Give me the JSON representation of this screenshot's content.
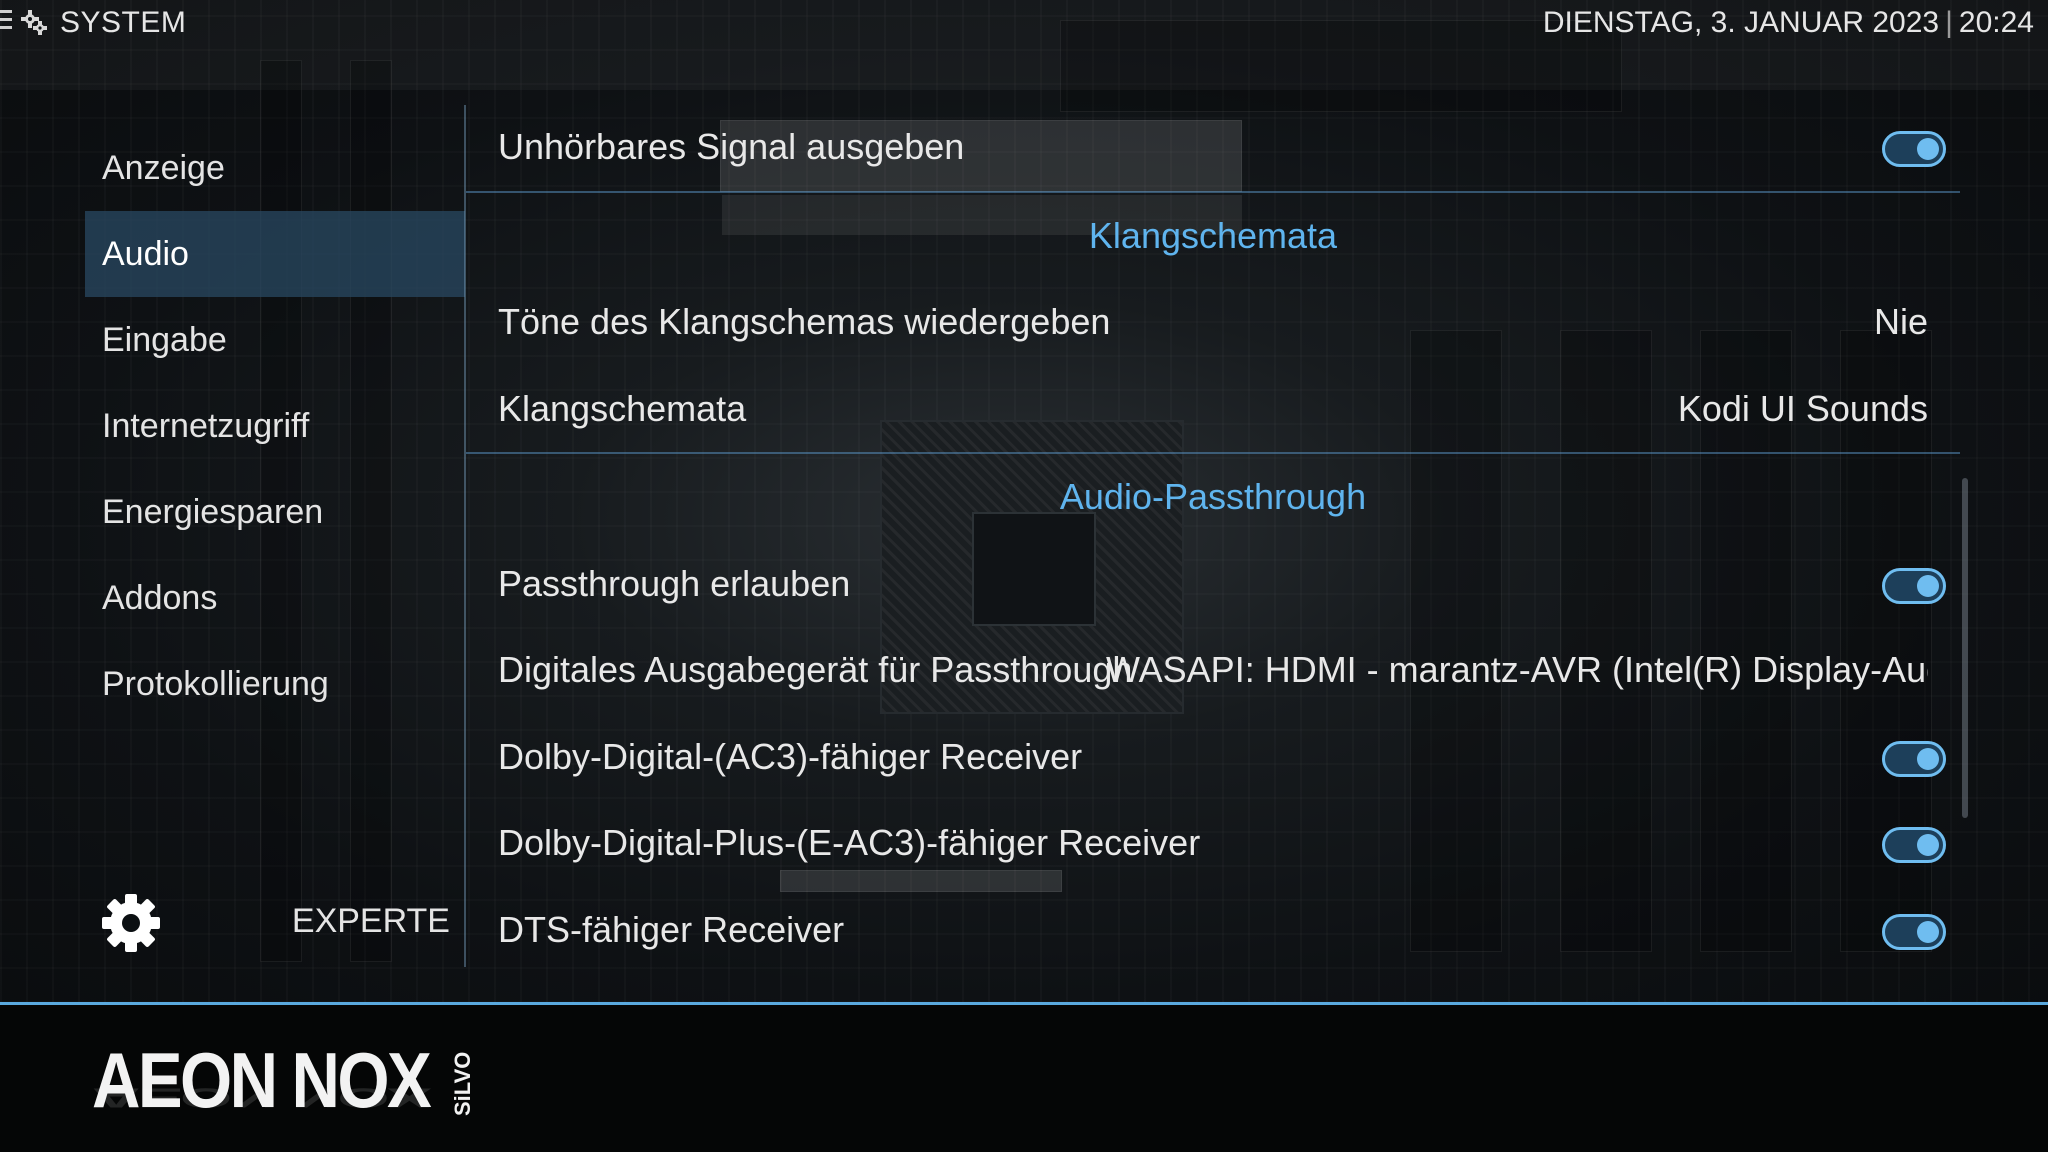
{
  "header": {
    "section_title": "SYSTEM",
    "date": "DIENSTAG, 3. JANUAR 2023",
    "separator": "|",
    "time": "20:24"
  },
  "sidebar": {
    "items": [
      {
        "label": "Anzeige",
        "active": false
      },
      {
        "label": "Audio",
        "active": true
      },
      {
        "label": "Eingabe",
        "active": false
      },
      {
        "label": "Internetzugriff",
        "active": false
      },
      {
        "label": "Energiesparen",
        "active": false
      },
      {
        "label": "Addons",
        "active": false
      },
      {
        "label": "Protokollierung",
        "active": false
      }
    ],
    "level_label": "EXPERTE",
    "level_icon": "gear-icon"
  },
  "settings": {
    "row0": {
      "label": "Unhörbares Signal ausgeben",
      "toggle": true
    },
    "section1": "Klangschemata",
    "row1": {
      "label": "Töne des Klangschemas wiedergeben",
      "value": "Nie"
    },
    "row2": {
      "label": "Klangschemata",
      "value": "Kodi UI Sounds"
    },
    "section2": "Audio-Passthrough",
    "row3": {
      "label": "Passthrough erlauben",
      "toggle": true
    },
    "row4": {
      "label": "Digitales Ausgabegerät für Passthrough",
      "value": "WASAPI: HDMI - marantz-AVR (Intel(R) Display-Audio)..."
    },
    "row5": {
      "label": "Dolby-Digital-(AC3)-fähiger Receiver",
      "toggle": true
    },
    "row6": {
      "label": "Dolby-Digital-Plus-(E-AC3)-fähiger Receiver",
      "toggle": true
    },
    "row7": {
      "label": "DTS-fähiger Receiver",
      "toggle": true
    }
  },
  "footer": {
    "logo_main": "AEON NOX",
    "logo_sub": "SiLVO"
  },
  "colors": {
    "accent": "#5fb4ee",
    "active_bg": "#28465f",
    "footer_line": "#5aa9de"
  }
}
